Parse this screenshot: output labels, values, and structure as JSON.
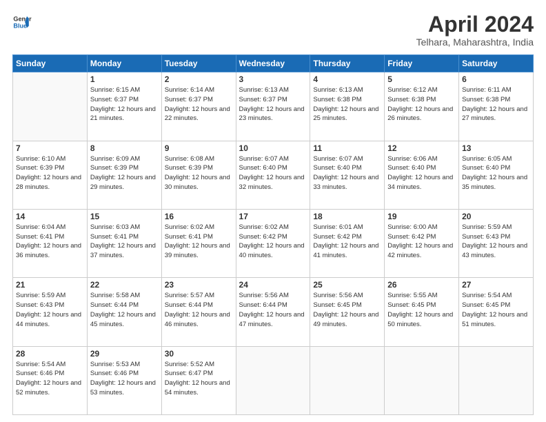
{
  "header": {
    "logo_line1": "General",
    "logo_line2": "Blue",
    "main_title": "April 2024",
    "subtitle": "Telhara, Maharashtra, India"
  },
  "weekdays": [
    "Sunday",
    "Monday",
    "Tuesday",
    "Wednesday",
    "Thursday",
    "Friday",
    "Saturday"
  ],
  "weeks": [
    [
      {
        "day": "",
        "info": ""
      },
      {
        "day": "1",
        "info": "Sunrise: 6:15 AM\nSunset: 6:37 PM\nDaylight: 12 hours\nand 21 minutes."
      },
      {
        "day": "2",
        "info": "Sunrise: 6:14 AM\nSunset: 6:37 PM\nDaylight: 12 hours\nand 22 minutes."
      },
      {
        "day": "3",
        "info": "Sunrise: 6:13 AM\nSunset: 6:37 PM\nDaylight: 12 hours\nand 23 minutes."
      },
      {
        "day": "4",
        "info": "Sunrise: 6:13 AM\nSunset: 6:38 PM\nDaylight: 12 hours\nand 25 minutes."
      },
      {
        "day": "5",
        "info": "Sunrise: 6:12 AM\nSunset: 6:38 PM\nDaylight: 12 hours\nand 26 minutes."
      },
      {
        "day": "6",
        "info": "Sunrise: 6:11 AM\nSunset: 6:38 PM\nDaylight: 12 hours\nand 27 minutes."
      }
    ],
    [
      {
        "day": "7",
        "info": "Sunrise: 6:10 AM\nSunset: 6:39 PM\nDaylight: 12 hours\nand 28 minutes."
      },
      {
        "day": "8",
        "info": "Sunrise: 6:09 AM\nSunset: 6:39 PM\nDaylight: 12 hours\nand 29 minutes."
      },
      {
        "day": "9",
        "info": "Sunrise: 6:08 AM\nSunset: 6:39 PM\nDaylight: 12 hours\nand 30 minutes."
      },
      {
        "day": "10",
        "info": "Sunrise: 6:07 AM\nSunset: 6:40 PM\nDaylight: 12 hours\nand 32 minutes."
      },
      {
        "day": "11",
        "info": "Sunrise: 6:07 AM\nSunset: 6:40 PM\nDaylight: 12 hours\nand 33 minutes."
      },
      {
        "day": "12",
        "info": "Sunrise: 6:06 AM\nSunset: 6:40 PM\nDaylight: 12 hours\nand 34 minutes."
      },
      {
        "day": "13",
        "info": "Sunrise: 6:05 AM\nSunset: 6:40 PM\nDaylight: 12 hours\nand 35 minutes."
      }
    ],
    [
      {
        "day": "14",
        "info": "Sunrise: 6:04 AM\nSunset: 6:41 PM\nDaylight: 12 hours\nand 36 minutes."
      },
      {
        "day": "15",
        "info": "Sunrise: 6:03 AM\nSunset: 6:41 PM\nDaylight: 12 hours\nand 37 minutes."
      },
      {
        "day": "16",
        "info": "Sunrise: 6:02 AM\nSunset: 6:41 PM\nDaylight: 12 hours\nand 39 minutes."
      },
      {
        "day": "17",
        "info": "Sunrise: 6:02 AM\nSunset: 6:42 PM\nDaylight: 12 hours\nand 40 minutes."
      },
      {
        "day": "18",
        "info": "Sunrise: 6:01 AM\nSunset: 6:42 PM\nDaylight: 12 hours\nand 41 minutes."
      },
      {
        "day": "19",
        "info": "Sunrise: 6:00 AM\nSunset: 6:42 PM\nDaylight: 12 hours\nand 42 minutes."
      },
      {
        "day": "20",
        "info": "Sunrise: 5:59 AM\nSunset: 6:43 PM\nDaylight: 12 hours\nand 43 minutes."
      }
    ],
    [
      {
        "day": "21",
        "info": "Sunrise: 5:59 AM\nSunset: 6:43 PM\nDaylight: 12 hours\nand 44 minutes."
      },
      {
        "day": "22",
        "info": "Sunrise: 5:58 AM\nSunset: 6:44 PM\nDaylight: 12 hours\nand 45 minutes."
      },
      {
        "day": "23",
        "info": "Sunrise: 5:57 AM\nSunset: 6:44 PM\nDaylight: 12 hours\nand 46 minutes."
      },
      {
        "day": "24",
        "info": "Sunrise: 5:56 AM\nSunset: 6:44 PM\nDaylight: 12 hours\nand 47 minutes."
      },
      {
        "day": "25",
        "info": "Sunrise: 5:56 AM\nSunset: 6:45 PM\nDaylight: 12 hours\nand 49 minutes."
      },
      {
        "day": "26",
        "info": "Sunrise: 5:55 AM\nSunset: 6:45 PM\nDaylight: 12 hours\nand 50 minutes."
      },
      {
        "day": "27",
        "info": "Sunrise: 5:54 AM\nSunset: 6:45 PM\nDaylight: 12 hours\nand 51 minutes."
      }
    ],
    [
      {
        "day": "28",
        "info": "Sunrise: 5:54 AM\nSunset: 6:46 PM\nDaylight: 12 hours\nand 52 minutes."
      },
      {
        "day": "29",
        "info": "Sunrise: 5:53 AM\nSunset: 6:46 PM\nDaylight: 12 hours\nand 53 minutes."
      },
      {
        "day": "30",
        "info": "Sunrise: 5:52 AM\nSunset: 6:47 PM\nDaylight: 12 hours\nand 54 minutes."
      },
      {
        "day": "",
        "info": ""
      },
      {
        "day": "",
        "info": ""
      },
      {
        "day": "",
        "info": ""
      },
      {
        "day": "",
        "info": ""
      }
    ]
  ]
}
